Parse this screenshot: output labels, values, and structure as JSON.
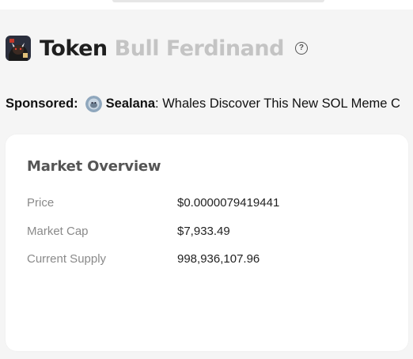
{
  "header": {
    "token_label": "Token",
    "token_name": "Bull Ferdinand",
    "help_icon": "help-circle-icon"
  },
  "sponsored": {
    "label": "Sponsored:",
    "sponsor_name": "Sealana",
    "text": ": Whales Discover This New SOL Meme C"
  },
  "market_overview": {
    "title": "Market Overview",
    "rows": [
      {
        "label": "Price",
        "value": "$0.0000079419441"
      },
      {
        "label": "Market Cap",
        "value": "$7,933.49"
      },
      {
        "label": "Current Supply",
        "value": "998,936,107.96"
      }
    ]
  },
  "colors": {
    "background": "#f5f5f5",
    "card": "#ffffff",
    "token_name": "#c4c4c4",
    "muted_label": "#8a8a8a"
  }
}
